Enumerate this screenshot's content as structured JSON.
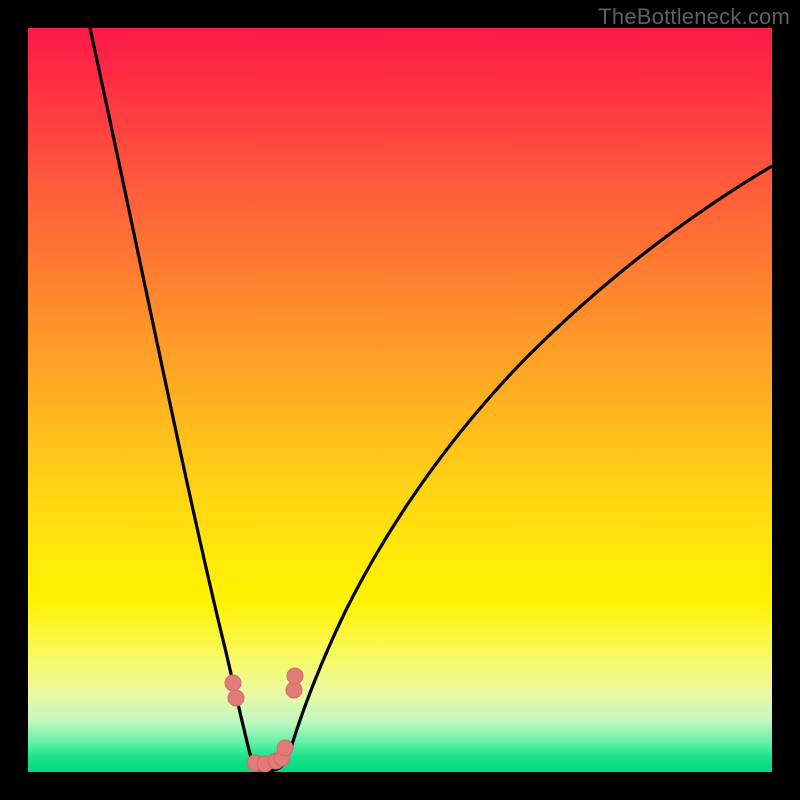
{
  "watermark": "TheBottleneck.com",
  "colors": {
    "frame": "#000000",
    "curve_stroke": "#000000",
    "marker_fill": "#e27a7a",
    "marker_stroke": "#d46b6b"
  },
  "chart_data": {
    "type": "line",
    "title": "",
    "xlabel": "",
    "ylabel": "",
    "xlim": [
      0,
      100
    ],
    "ylim": [
      0,
      100
    ],
    "x": [
      10,
      12,
      14,
      16,
      18,
      20,
      22,
      24,
      26,
      27,
      28,
      29,
      30,
      31,
      32,
      33,
      34,
      36,
      38,
      40,
      44,
      48,
      52,
      56,
      60,
      64,
      68,
      72,
      76,
      80,
      84,
      88,
      92,
      96,
      100
    ],
    "y": [
      100,
      92,
      84,
      76,
      68,
      60,
      52,
      44,
      35,
      30,
      23,
      14,
      5,
      0,
      0,
      0,
      3,
      9,
      15,
      20,
      29,
      36,
      43,
      49,
      54,
      59,
      63,
      67,
      70,
      73,
      76,
      78,
      80,
      82,
      84
    ],
    "markers": [
      {
        "x": 27.2,
        "y": 12
      },
      {
        "x": 27.6,
        "y": 10
      },
      {
        "x": 30.5,
        "y": 1
      },
      {
        "x": 31.8,
        "y": 1
      },
      {
        "x": 33.2,
        "y": 1.5
      },
      {
        "x": 34.0,
        "y": 2
      },
      {
        "x": 34.5,
        "y": 3.5
      },
      {
        "x": 35.5,
        "y": 11
      },
      {
        "x": 35.6,
        "y": 13
      }
    ],
    "background_gradient_note": "vertical rainbow gradient red->green indicating severity; minimum of curve sits in green band"
  }
}
